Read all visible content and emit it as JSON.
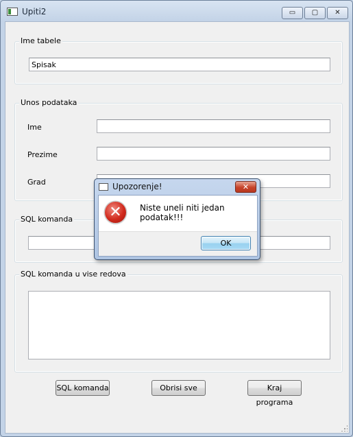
{
  "window": {
    "title": "Upiti2"
  },
  "window_controls": {
    "minimize": "▭",
    "maximize": "▢",
    "close": "✕"
  },
  "ime_tabele": {
    "title": "Ime tabele",
    "value": "Spisak"
  },
  "unos_podataka": {
    "title": "Unos podataka",
    "ime_label": "Ime",
    "ime_value": "",
    "prezime_label": "Prezime",
    "prezime_value": "",
    "grad_label": "Grad",
    "grad_value": ""
  },
  "sql_komanda": {
    "title": "SQL komanda",
    "value": ""
  },
  "sql_vise_redova": {
    "title": "SQL komanda u vise redova"
  },
  "buttons": {
    "sql_komanda": "SQL komanda",
    "obrisi_sve": "Obrisi sve",
    "kraj_programa": "Kraj programa"
  },
  "dialog": {
    "title": "Upozorenje!",
    "close": "✕",
    "icon": "error-icon",
    "message": "Niste uneli niti jedan podatak!!!",
    "ok": "OK"
  },
  "colors": {
    "title_bar": "#c3d3e7",
    "dialog_close": "#c7432a",
    "error": "#d12a1d"
  }
}
